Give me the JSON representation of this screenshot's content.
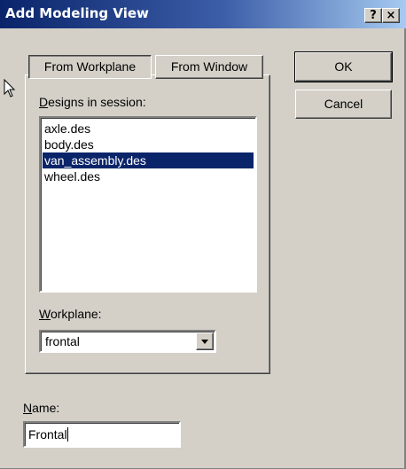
{
  "title": "Add Modeling View",
  "caption_buttons": {
    "help": "?",
    "close": "×"
  },
  "tabs": [
    {
      "label": "From Workplane"
    },
    {
      "label": "From Window"
    }
  ],
  "designs": {
    "label_u": "D",
    "label_rest": "esigns in session:",
    "items": [
      "axle.des",
      "body.des",
      "van_assembly.des",
      "wheel.des"
    ],
    "selected": "van_assembly.des"
  },
  "workplane": {
    "label_u": "W",
    "label_rest": "orkplane:",
    "value": "frontal"
  },
  "buttons": {
    "ok": "OK",
    "cancel": "Cancel"
  },
  "name": {
    "label_u": "N",
    "label_rest": "ame:",
    "value": "Frontal"
  },
  "colors": {
    "title_bar": "#0a246a",
    "face": "#d4d0c8",
    "selection": "#0a246a"
  }
}
